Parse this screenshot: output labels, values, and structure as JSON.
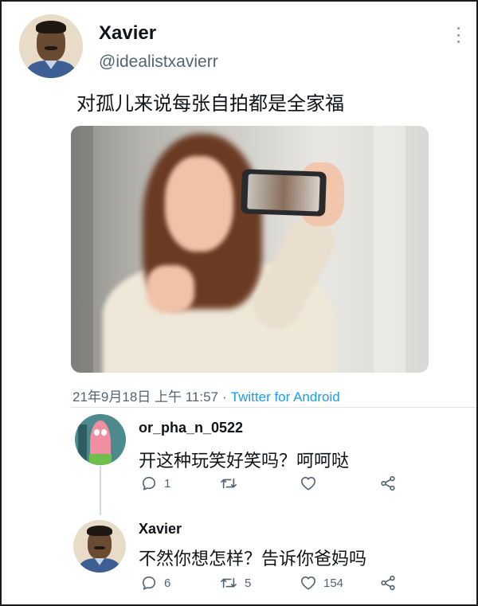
{
  "tweet": {
    "author_name": "Xavier",
    "author_handle": "@idealistxavierr",
    "text": "对孤儿来说每张自拍都是全家福",
    "date": "21年9月18日 上午 11:57",
    "separator": "·",
    "source": "Twitter for Android"
  },
  "replies": [
    {
      "author_name": "or_pha_n_0522",
      "text": "开这种玩笑好笑吗？呵呵哒",
      "reply_count": "1",
      "retweet_count": "",
      "like_count": ""
    },
    {
      "author_name": "Xavier",
      "text": "不然你想怎样？告诉你爸妈吗",
      "reply_count": "6",
      "retweet_count": "5",
      "like_count": "154"
    }
  ],
  "colors": {
    "text_primary": "#0f1419",
    "text_secondary": "#536471",
    "link": "#1d9bf0",
    "icon": "#536471"
  },
  "icons": [
    "more-vertical-icon",
    "reply-icon",
    "retweet-icon",
    "like-icon",
    "share-icon"
  ]
}
